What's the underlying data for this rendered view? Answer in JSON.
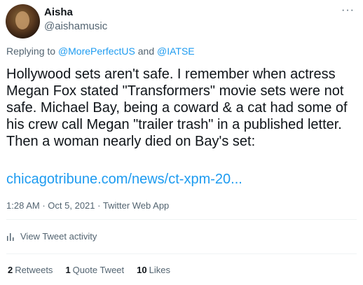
{
  "author": {
    "name": "Aisha",
    "handle": "@aishamusic"
  },
  "more_icon": "ellipsis-icon",
  "replying": {
    "prefix": "Replying to",
    "mention1": "@MorePerfectUS",
    "conjunction": "and",
    "mention2": "@IATSE"
  },
  "tweet": {
    "text": "Hollywood sets aren't safe. I remember when actress Megan Fox stated \"Transformers\" movie sets were not safe. Michael Bay, being a coward & a cat had some of his crew call Megan \"trailer trash\" in a published letter. Then a woman nearly died on Bay's set:",
    "link": "chicagotribune.com/news/ct-xpm-20..."
  },
  "meta": {
    "time": "1:28 AM",
    "separator": "·",
    "date": "Oct 5, 2021",
    "source": "Twitter Web App"
  },
  "activity": {
    "label": "View Tweet activity",
    "icon": "bar-chart-icon"
  },
  "stats": {
    "retweets_count": "2",
    "retweets_label": "Retweets",
    "quotes_count": "1",
    "quotes_label": "Quote Tweet",
    "likes_count": "10",
    "likes_label": "Likes"
  },
  "colors": {
    "link": "#1d9bf0",
    "secondary": "#536471",
    "primary": "#0f1419"
  }
}
